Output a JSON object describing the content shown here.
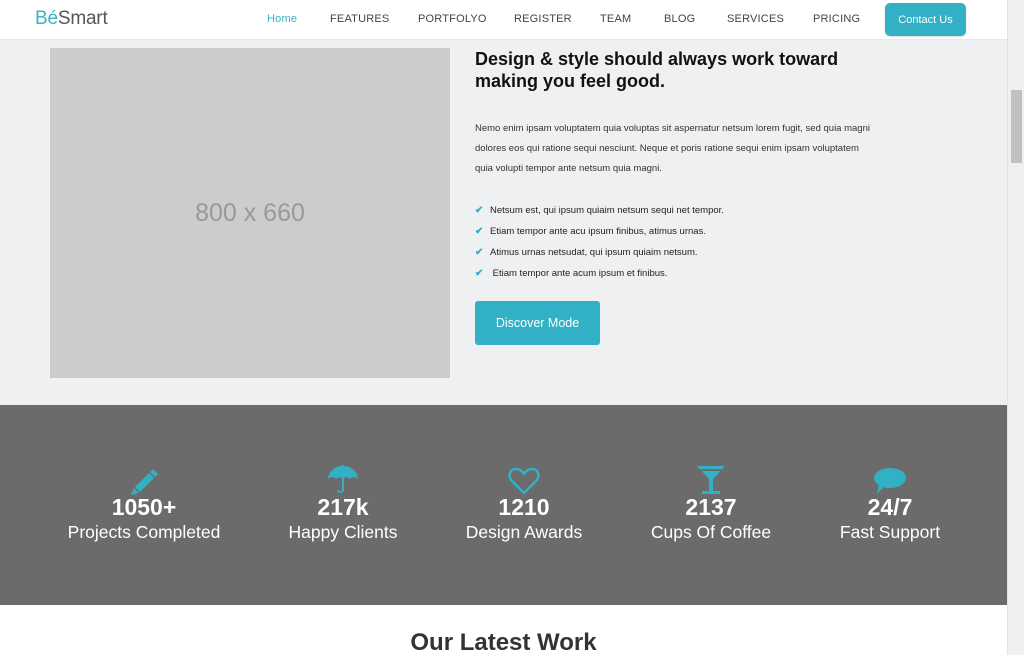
{
  "navbar": {
    "brand_prefix": "Bé",
    "brand_suffix": "Smart",
    "items": [
      {
        "label": "Home",
        "active": true
      },
      {
        "label": "FEATURES"
      },
      {
        "label": "PORTFOLYO"
      },
      {
        "label": "REGISTER"
      },
      {
        "label": "TEAM"
      },
      {
        "label": "BLOG"
      },
      {
        "label": "SERVICES"
      },
      {
        "label": "PRICING"
      }
    ],
    "contact_label": "Contact Us"
  },
  "about": {
    "placeholder_text": "800 x 660",
    "title": "Design & style should always work toward making you feel good.",
    "paragraph": "Nemo enim ipsam voluptatem quia voluptas sit aspernatur netsum lorem fugit, sed quia magni dolores eos qui ratione sequi nesciunt. Neque et poris ratione sequi enim ipsam voluptatem quia volupti tempor ante netsum quia magni.",
    "features": [
      "Netsum est, qui ipsum quiaim netsum sequi net tempor.",
      "Etiam tempor ante acu ipsum finibus, atimus urnas.",
      "Atimus urnas netsudat, qui ipsum quiaim netsum.",
      " Etiam tempor ante acum ipsum et finibus."
    ],
    "button_label": "Discover Mode"
  },
  "stats": [
    {
      "icon": "pencil-icon",
      "number": "1050+",
      "label": "Projects Completed"
    },
    {
      "icon": "umbrella-icon",
      "number": "217k",
      "label": "Happy Clients"
    },
    {
      "icon": "heart-icon",
      "number": "1210",
      "label": "Design Awards"
    },
    {
      "icon": "cocktail-glass-icon",
      "number": "2137",
      "label": "Cups Of Coffee"
    },
    {
      "icon": "speech-bubble-icon",
      "number": "24/7",
      "label": "Fast Support"
    }
  ],
  "latest": {
    "title": "Our Latest Work"
  },
  "colors": {
    "accent": "#31b0c6",
    "stats_bg": "#6b6b6b",
    "about_bg": "#eef0f2"
  }
}
